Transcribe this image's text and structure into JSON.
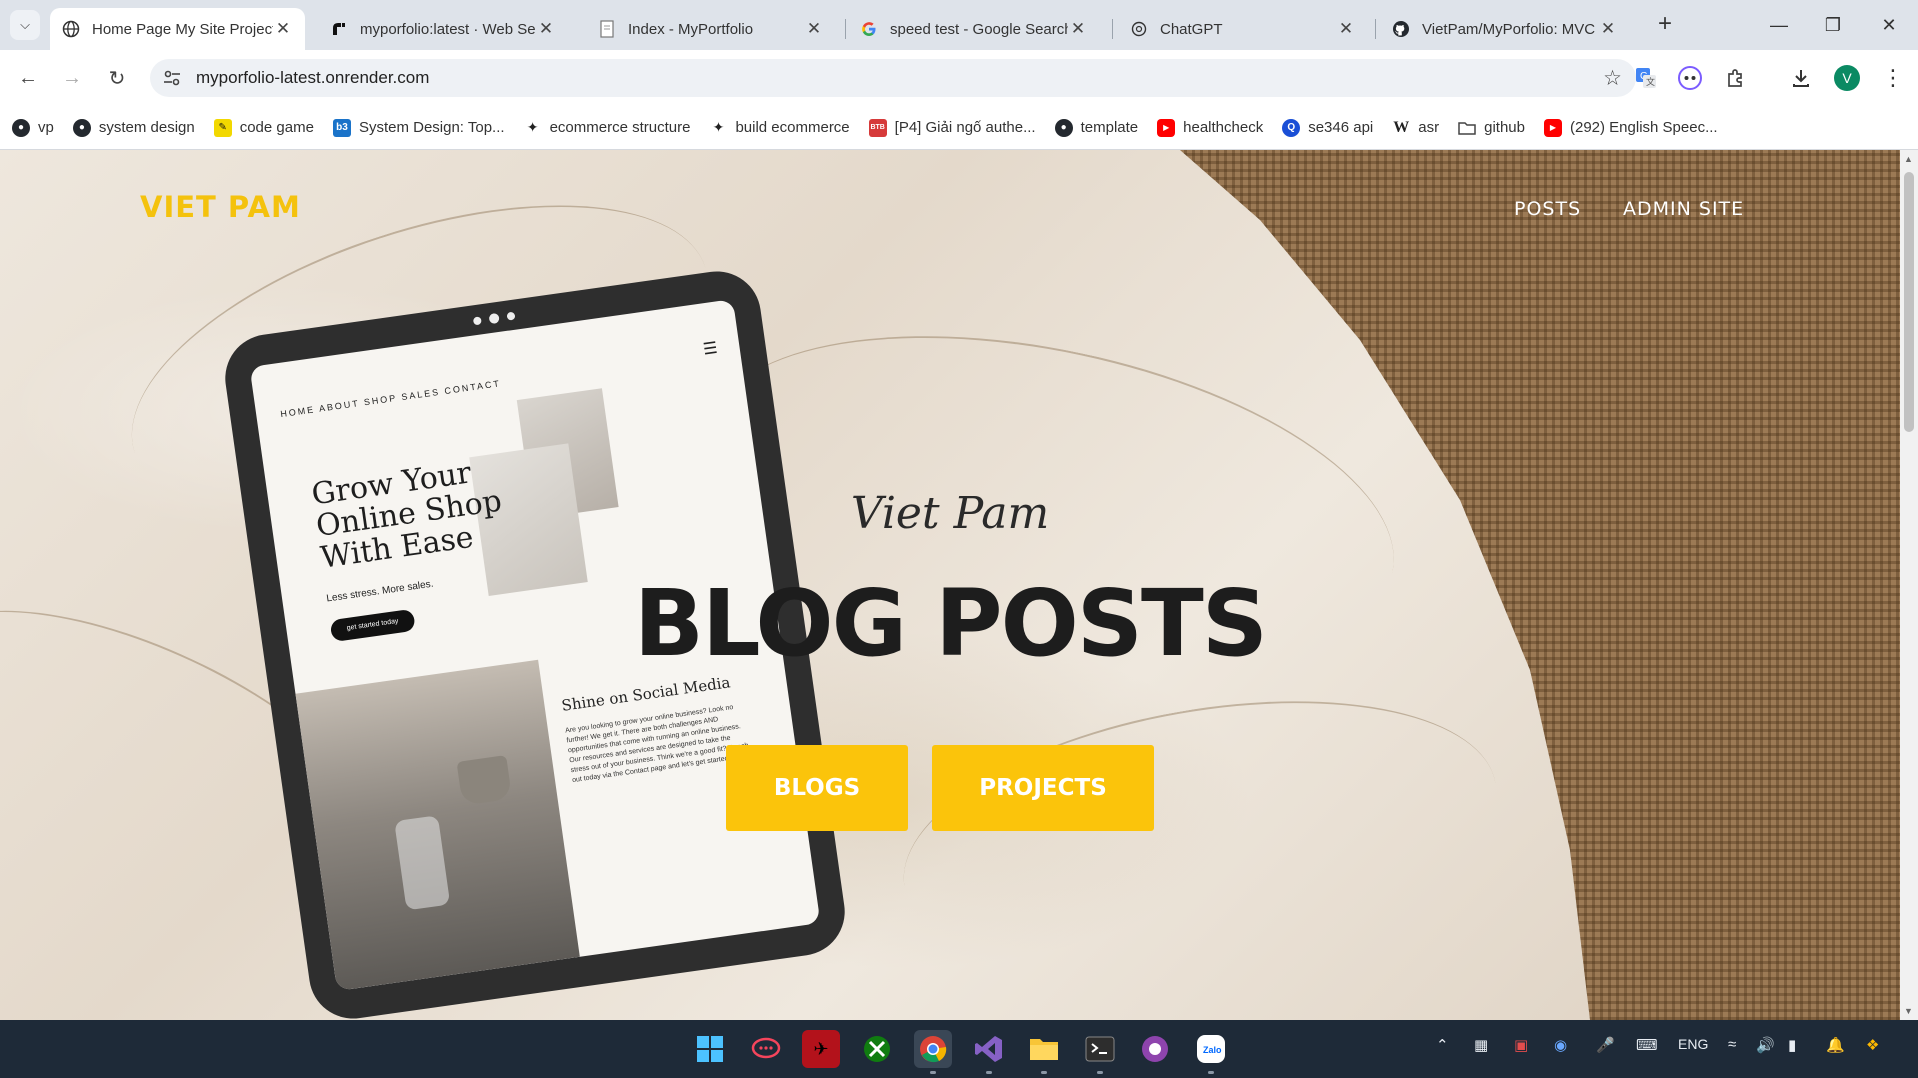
{
  "browser": {
    "tabs": [
      {
        "title": "Home Page My Site Project",
        "icon": "globe-icon",
        "active": true
      },
      {
        "title": "myporfolio:latest · Web Se",
        "icon": "render-icon",
        "active": false
      },
      {
        "title": "Index - MyPortfolio",
        "icon": "page-icon",
        "active": false
      },
      {
        "title": "speed test - Google Search",
        "icon": "google-icon",
        "active": false
      },
      {
        "title": "ChatGPT",
        "icon": "chatgpt-icon",
        "active": false
      },
      {
        "title": "VietPam/MyPorfolio: MVC",
        "icon": "github-icon",
        "active": false
      }
    ],
    "new_tab_label": "+",
    "url": "myporfolio-latest.onrender.com",
    "profile_initial": "V",
    "bookmarks": [
      {
        "label": "vp",
        "icon": "github-icon"
      },
      {
        "label": "system design",
        "icon": "github-icon"
      },
      {
        "label": "code game",
        "icon": "codegame-icon"
      },
      {
        "label": "System Design: Top...",
        "icon": "d3-icon"
      },
      {
        "label": "ecommerce structure",
        "icon": "ink-icon"
      },
      {
        "label": "build ecommerce",
        "icon": "ink-icon"
      },
      {
        "label": "[P4] Giải ngố authe...",
        "icon": "bookmark-red-icon"
      },
      {
        "label": "template",
        "icon": "github-icon"
      },
      {
        "label": "healthcheck",
        "icon": "youtube-icon"
      },
      {
        "label": "se346 api",
        "icon": "q-icon"
      },
      {
        "label": "asr",
        "icon": "wikipedia-icon"
      },
      {
        "label": "github",
        "icon": "folder-icon"
      },
      {
        "label": "(292) English Speec...",
        "icon": "youtube-icon"
      }
    ]
  },
  "site": {
    "brand": "VIET PAM",
    "nav": [
      "POSTS",
      "ADMIN SITE"
    ],
    "hero_subtitle": "Viet Pam",
    "hero_title": "BLOG POSTS",
    "buttons": [
      "BLOGS",
      "PROJECTS"
    ],
    "accent_color": "#fbc40b",
    "tablet": {
      "nav_text": "HOME ABOUT SHOP SALES CONTACT",
      "headline_lines": [
        "Grow Your",
        "Online Shop",
        "With Ease"
      ],
      "subline": "Less stress. More sales.",
      "button": "get started today",
      "social_title": "Shine on Social Media",
      "social_text": "Are you looking to grow your online business? Look no further! We get it. There are both challenges AND opportunities that come with running an online business. Our resources and services are designed to take the stress out of your business. Think we're a good fit? Reach out today via the Contact page and let's get started!"
    }
  },
  "taskbar": {
    "apps": [
      "windows-start-icon",
      "rocket-chat-icon",
      "terminal-red-icon",
      "xbox-icon",
      "chrome-icon",
      "visual-studio-icon",
      "file-explorer-icon",
      "windows-terminal-icon",
      "github-desktop-icon",
      "zalo-icon"
    ],
    "language": "ENG"
  }
}
